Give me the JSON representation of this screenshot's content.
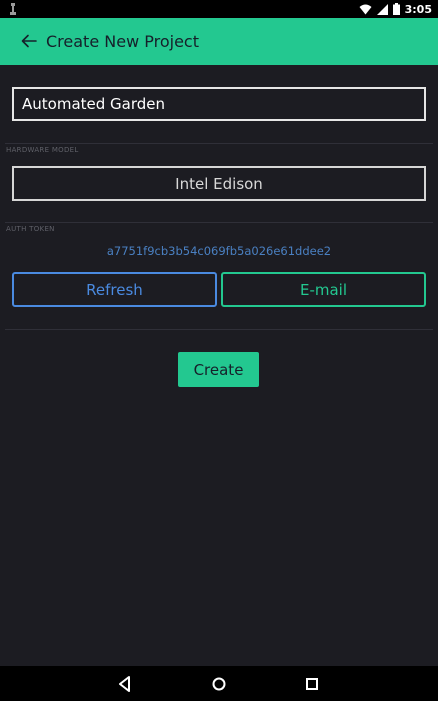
{
  "status_bar": {
    "time": "3:05",
    "icons": [
      "usb-debug-icon",
      "wifi-icon",
      "signal-icon",
      "battery-icon"
    ]
  },
  "app_bar": {
    "title": "Create New Project",
    "back_icon": "arrow-left-icon",
    "background": "#23c890"
  },
  "project_name": {
    "value": "Automated Garden"
  },
  "hardware": {
    "label": "HARDWARE MODEL",
    "selected": "Intel Edison"
  },
  "auth": {
    "label": "AUTH TOKEN",
    "token": "a7751f9cb3b54c069fb5a026e61ddee2",
    "refresh_label": "Refresh",
    "email_label": "E-mail"
  },
  "create_label": "Create",
  "nav": {
    "icons": [
      "back-triangle-icon",
      "home-circle-icon",
      "recents-square-icon"
    ]
  },
  "colors": {
    "accent": "#23c890",
    "link_blue": "#4a8ae0",
    "background": "#1c1c22"
  }
}
